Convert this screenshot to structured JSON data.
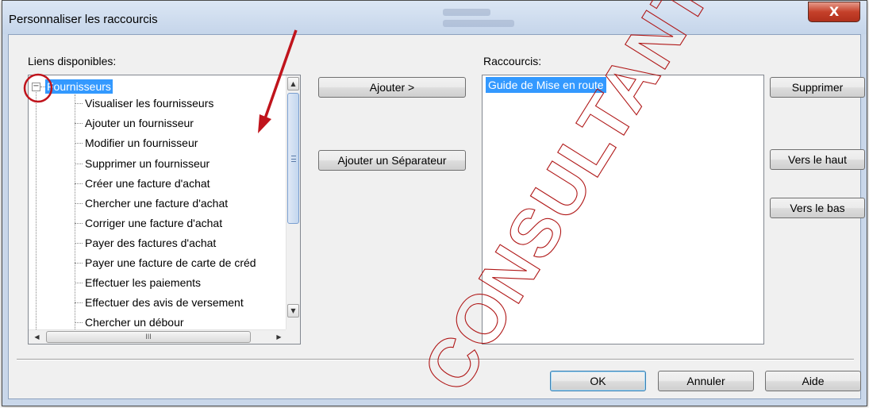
{
  "window": {
    "title": "Personnaliser les raccourcis",
    "close_glyph": "X"
  },
  "available": {
    "label": "Liens disponibles:",
    "root": {
      "expander": "−",
      "label": "Fournisseurs"
    },
    "items": [
      "Visualiser les fournisseurs",
      "Ajouter un fournisseur",
      "Modifier un fournisseur",
      "Supprimer un fournisseur",
      "Créer une  facture d'achat",
      "Chercher une facture d'achat",
      "Corriger une facture d'achat",
      "Payer des factures d'achat",
      "Payer une facture de carte de créd",
      "Effectuer les paiements",
      "Effectuer des avis de versement",
      "Chercher un débour"
    ],
    "scroll_up": "▲",
    "scroll_down": "▼",
    "scroll_left": "◀",
    "scroll_right": "▶",
    "hthumb_grip": "III"
  },
  "actions": {
    "add": "Ajouter >",
    "add_separator": "Ajouter un Séparateur"
  },
  "shortcuts": {
    "label": "Raccourcis:",
    "items": [
      "Guide de Mise en route"
    ]
  },
  "side_buttons": {
    "delete": "Supprimer",
    "up": "Vers le haut",
    "down": "Vers le bas"
  },
  "footer": {
    "ok": "OK",
    "cancel": "Annuler",
    "help": "Aide"
  },
  "watermark": "CONSULTANTS",
  "colors": {
    "selection": "#3399ff",
    "annotation": "#c0141c",
    "watermark_outline": "#b01818"
  }
}
